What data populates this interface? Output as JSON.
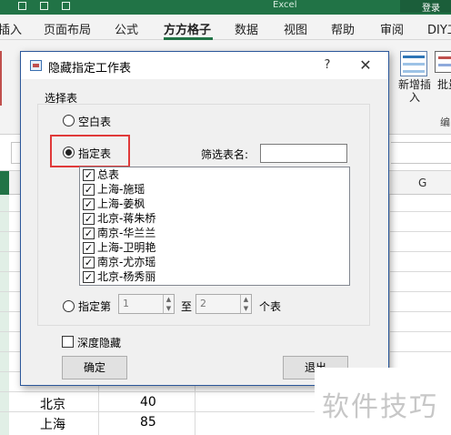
{
  "excel": {
    "title_right": "Excel",
    "title_button": "登录",
    "tabs": [
      "插入",
      "页面布局",
      "公式",
      "方方格子",
      "数据",
      "视图",
      "帮助",
      "审阅",
      "DIY工"
    ],
    "active_tab": "方方格子",
    "ribbon": {
      "new_insert_label": "新增插\n入",
      "batch_label": "批量",
      "group_label": "编"
    },
    "column_headers": [
      "G"
    ],
    "rows": [
      {
        "region": "北京",
        "value": "40"
      },
      {
        "region": "上海",
        "value": "85"
      }
    ],
    "accent": "#217346"
  },
  "dialog": {
    "title": "隐藏指定工作表",
    "help": "?",
    "close": "✕",
    "group_title": "选择表",
    "radio_blank": "空白表",
    "radio_specified": "指定表",
    "filter_label": "筛选表名:",
    "filter_value": "",
    "sheets": [
      {
        "name": "总表",
        "checked": true
      },
      {
        "name": "上海-施瑶",
        "checked": true
      },
      {
        "name": "上海-姜枫",
        "checked": true
      },
      {
        "name": "北京-蒋朱桥",
        "checked": true
      },
      {
        "name": "南京-华兰兰",
        "checked": true
      },
      {
        "name": "上海-卫明艳",
        "checked": true
      },
      {
        "name": "南京-尤亦瑶",
        "checked": true
      },
      {
        "name": "北京-杨秀丽",
        "checked": true
      }
    ],
    "range_prefix": "指定第",
    "range_from": "1",
    "range_to_label": "至",
    "range_to": "2",
    "range_suffix": "个表",
    "deep_hide": "深度隐藏",
    "ok": "确定",
    "exit": "退出",
    "highlight_color": "#e03a3a"
  },
  "watermark": "软件技巧"
}
